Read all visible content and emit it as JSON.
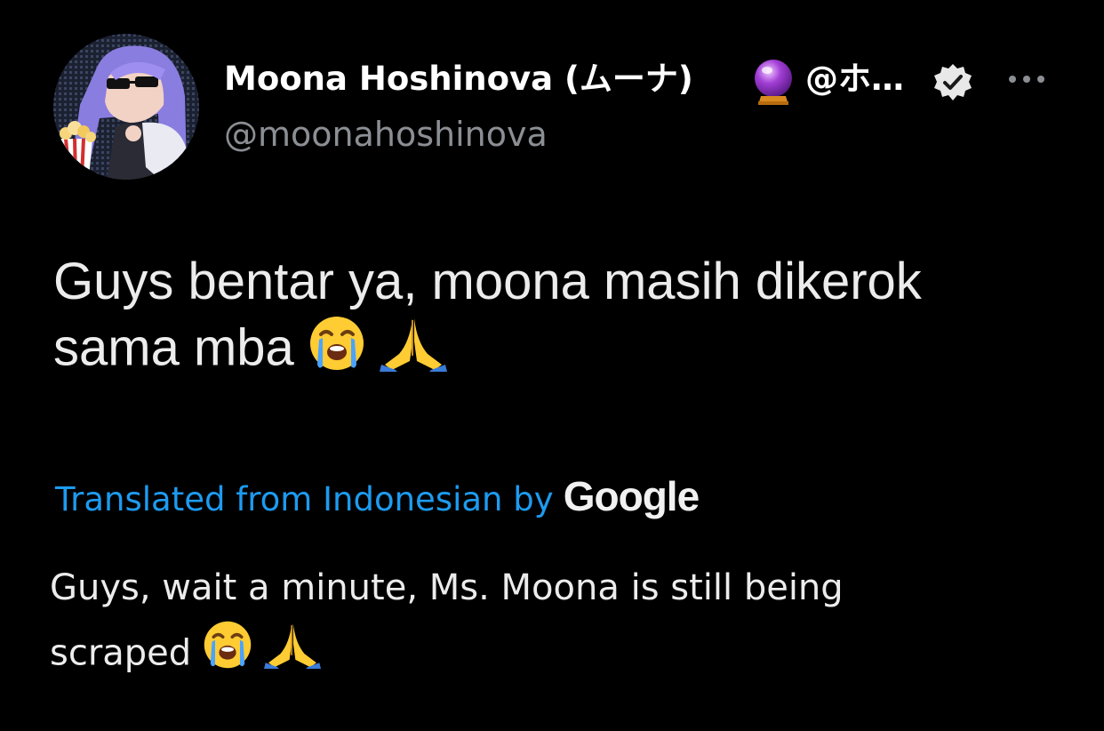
{
  "tweet": {
    "author": {
      "display_name": "Moona Hoshinova (ムーナ)",
      "display_name_tail": "@ホ…",
      "handle": "@moonahoshinova",
      "verified": true,
      "avatar_icon": "anime-avatar-sunglasses-popcorn"
    },
    "more_icon": "more-horizontal-icon",
    "text_lines": [
      "Guys bentar ya, moona masih dikerok",
      "sama mba"
    ],
    "translation": {
      "link_text": "Translated from Indonesian by",
      "provider": "Google",
      "text_lines": [
        "Guys, wait a minute, Ms. Moona is still being",
        "scraped"
      ]
    },
    "emojis": [
      "loudly-crying-face",
      "folded-hands"
    ]
  },
  "colors": {
    "background": "#000000",
    "text_primary": "#ffffff",
    "text_secondary": "#8b8f94",
    "link": "#1d9bf0"
  }
}
